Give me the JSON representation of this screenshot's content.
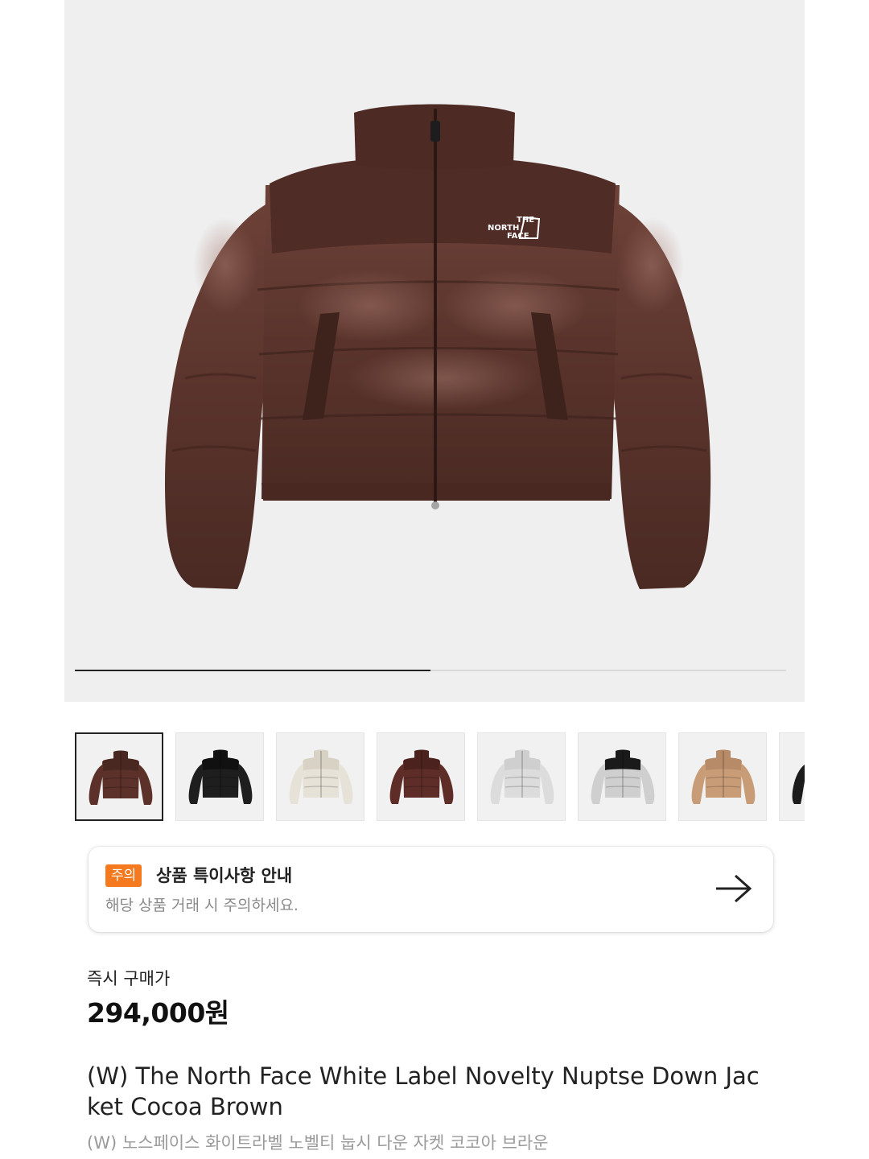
{
  "gallery": {
    "progress": 0.5,
    "main_image": {
      "name": "brown-down-jacket",
      "color": "#5a342c",
      "logo_lines": [
        "THE",
        "NORTH",
        "FACE"
      ]
    }
  },
  "thumbnails": [
    {
      "name": "cocoa-brown",
      "body": "#5b3129",
      "yoke": "#4a2822",
      "selected": true
    },
    {
      "name": "black",
      "body": "#1e1e1e",
      "yoke": "#111111",
      "selected": false
    },
    {
      "name": "ivory",
      "body": "#e6e2d8",
      "yoke": "#d8d2c4",
      "selected": false
    },
    {
      "name": "brown",
      "body": "#5e2d27",
      "yoke": "#4b221e",
      "selected": false
    },
    {
      "name": "light-grey",
      "body": "#dcdcdc",
      "yoke": "#cfcfcf",
      "selected": false
    },
    {
      "name": "silver-black",
      "body": "#cfcfcf",
      "yoke": "#1a1a1a",
      "selected": false
    },
    {
      "name": "tan",
      "body": "#c99c78",
      "yoke": "#b78b68",
      "selected": false
    },
    {
      "name": "black-partial",
      "body": "#1c1c1c",
      "yoke": "#111111",
      "selected": false
    }
  ],
  "notice": {
    "badge": "주의",
    "title": "상품 특이사항 안내",
    "subtitle": "해당 상품 거래 시 주의하세요."
  },
  "price": {
    "label": "즉시 구매가",
    "value": "294,000원"
  },
  "product": {
    "title_en": "(W) The North Face White Label Novelty Nuptse Down Jacket Cocoa Brown",
    "title_ko": "(W) 노스페이스 화이트라벨 노벨티 눕시 다운 자켓 코코아 브라운"
  }
}
